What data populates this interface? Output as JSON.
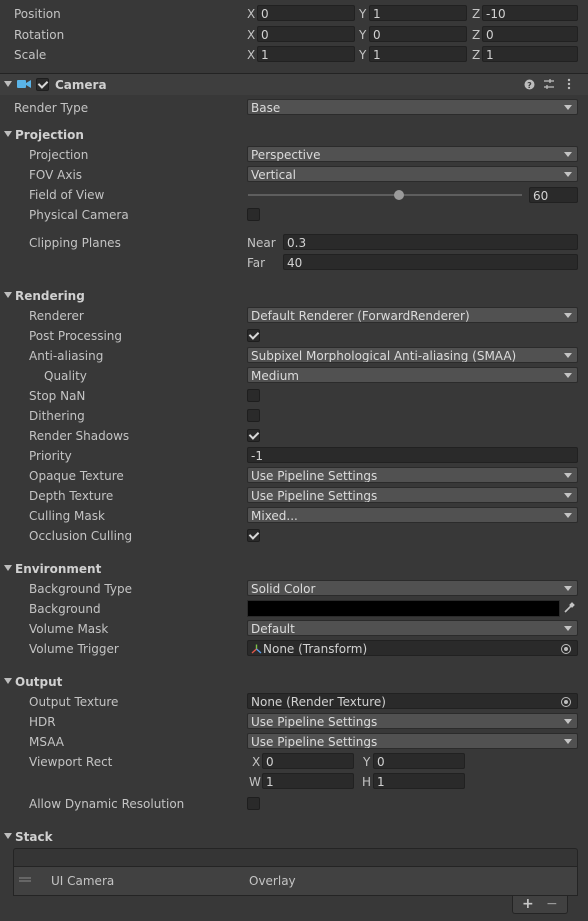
{
  "transform": {
    "position": {
      "label": "Position",
      "x": "0",
      "y": "1",
      "z": "-10"
    },
    "rotation": {
      "label": "Rotation",
      "x": "0",
      "y": "0",
      "z": "0"
    },
    "scale": {
      "label": "Scale",
      "x": "1",
      "y": "1",
      "z": "1"
    },
    "axis_x": "X",
    "axis_y": "Y",
    "axis_z": "Z"
  },
  "camera": {
    "title": "Camera",
    "enabled": true,
    "render_type": {
      "label": "Render Type",
      "value": "Base"
    }
  },
  "projection": {
    "header": "Projection",
    "projection": {
      "label": "Projection",
      "value": "Perspective"
    },
    "fov_axis": {
      "label": "FOV Axis",
      "value": "Vertical"
    },
    "field_of_view": {
      "label": "Field of View",
      "value": "60",
      "slider_fraction": 0.55
    },
    "physical_camera": {
      "label": "Physical Camera",
      "checked": false
    },
    "clipping_planes": {
      "label": "Clipping Planes",
      "near_label": "Near",
      "near": "0.3",
      "far_label": "Far",
      "far": "40"
    }
  },
  "rendering": {
    "header": "Rendering",
    "renderer": {
      "label": "Renderer",
      "value": "Default Renderer (ForwardRenderer)"
    },
    "post_processing": {
      "label": "Post Processing",
      "checked": true
    },
    "anti_aliasing": {
      "label": "Anti-aliasing",
      "value": "Subpixel Morphological Anti-aliasing (SMAA)"
    },
    "quality": {
      "label": "Quality",
      "value": "Medium"
    },
    "stop_nan": {
      "label": "Stop NaN",
      "checked": false
    },
    "dithering": {
      "label": "Dithering",
      "checked": false
    },
    "render_shadows": {
      "label": "Render Shadows",
      "checked": true
    },
    "priority": {
      "label": "Priority",
      "value": "-1"
    },
    "opaque_texture": {
      "label": "Opaque Texture",
      "value": "Use Pipeline Settings"
    },
    "depth_texture": {
      "label": "Depth Texture",
      "value": "Use Pipeline Settings"
    },
    "culling_mask": {
      "label": "Culling Mask",
      "value": "Mixed..."
    },
    "occlusion_culling": {
      "label": "Occlusion Culling",
      "checked": true
    }
  },
  "environment": {
    "header": "Environment",
    "background_type": {
      "label": "Background Type",
      "value": "Solid Color"
    },
    "background": {
      "label": "Background",
      "color": "#000000"
    },
    "volume_mask": {
      "label": "Volume Mask",
      "value": "Default"
    },
    "volume_trigger": {
      "label": "Volume Trigger",
      "value": "None (Transform)"
    }
  },
  "output": {
    "header": "Output",
    "output_texture": {
      "label": "Output Texture",
      "value": "None (Render Texture)"
    },
    "hdr": {
      "label": "HDR",
      "value": "Use Pipeline Settings"
    },
    "msaa": {
      "label": "MSAA",
      "value": "Use Pipeline Settings"
    },
    "viewport_rect": {
      "label": "Viewport Rect",
      "x_label": "X",
      "x": "0",
      "y_label": "Y",
      "y": "0",
      "w_label": "W",
      "w": "1",
      "h_label": "H",
      "h": "1"
    },
    "allow_dynamic_resolution": {
      "label": "Allow Dynamic Resolution",
      "checked": false
    }
  },
  "stack": {
    "header": "Stack",
    "items": [
      {
        "name": "UI Camera",
        "type": "Overlay"
      }
    ],
    "add": "+",
    "remove": "−"
  },
  "colors": {
    "panel": "#383838",
    "field": "#2a2a2a",
    "dropdown": "#515151",
    "header": "#3e3e3e",
    "accent": "#5ab4e8"
  }
}
